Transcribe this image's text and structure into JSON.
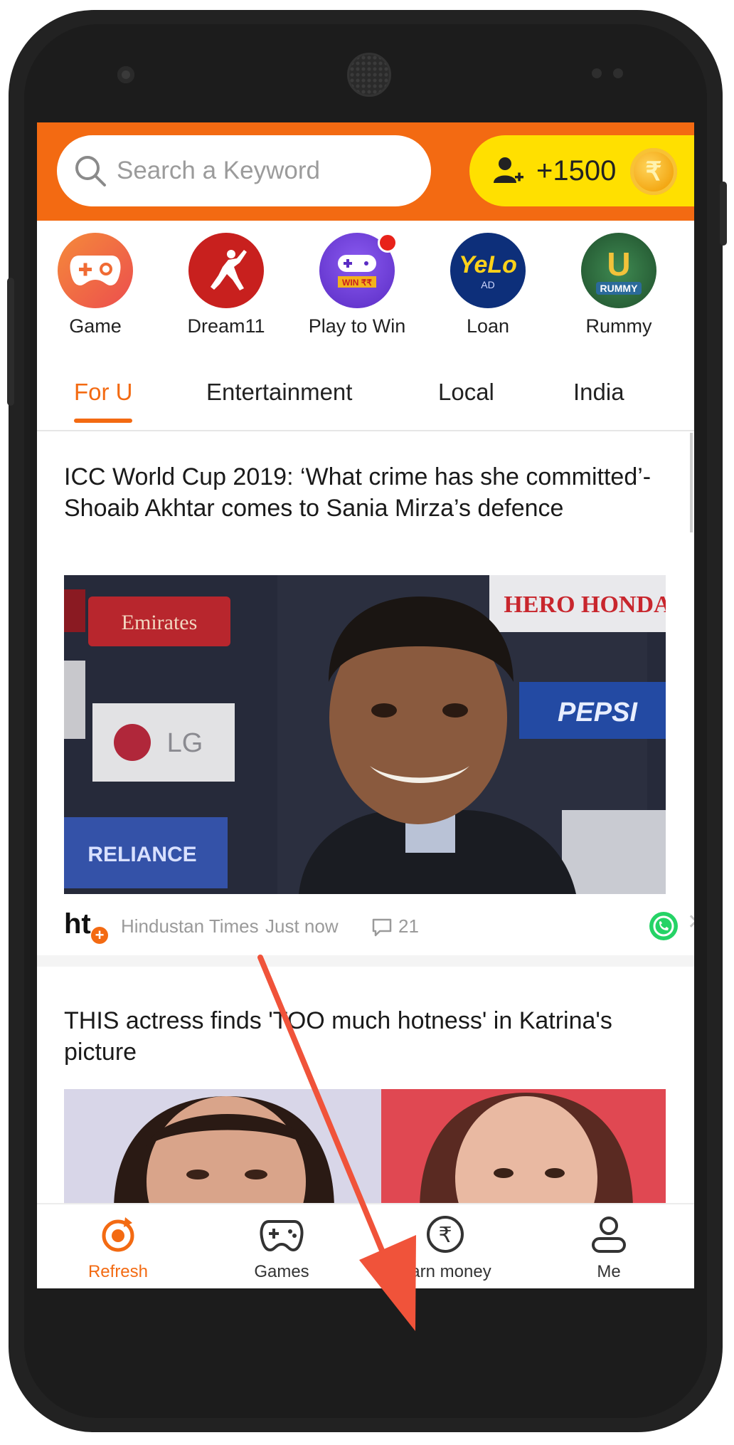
{
  "search": {
    "placeholder": "Search a Keyword"
  },
  "rewards": {
    "amount": "+1500",
    "currency_symbol": "₹"
  },
  "quick_apps": [
    {
      "label": "Game",
      "icon": "gamepad-icon",
      "color": "#f06b34"
    },
    {
      "label": "Dream11",
      "icon": "cricket-batsman-icon",
      "color": "#c8201e"
    },
    {
      "label": "Play to Win",
      "icon": "joystick-icon",
      "color": "#6a3bd6",
      "badge": "WIN ₹₹"
    },
    {
      "label": "Loan",
      "icon": "yelo-logo-icon",
      "color": "#0d2f7a",
      "logo": "YeLo",
      "sub": "AD"
    },
    {
      "label": "Rummy",
      "icon": "rummy-logo-icon",
      "color": "#2f6a3d",
      "logo": "U",
      "sub": "RUMMY"
    }
  ],
  "tabs": [
    {
      "label": "For U",
      "active": true
    },
    {
      "label": "Entertainment",
      "active": false
    },
    {
      "label": "Local",
      "active": false
    },
    {
      "label": "India",
      "active": false
    }
  ],
  "articles": [
    {
      "headline": "ICC World Cup 2019: ‘What crime has she committed’- Shoaib Akhtar comes to Sania Mirza’s defence",
      "source": "Hindustan Times",
      "time": "Just now",
      "comments": "21",
      "source_logo": "ht"
    },
    {
      "headline": "THIS actress finds 'TOO much hotness' in Katrina's picture"
    }
  ],
  "photo_backdrop": [
    "Emirates",
    "LG",
    "RELIANCE",
    "HERO HONDA",
    "PEPSI"
  ],
  "bottom_nav": [
    {
      "label": "Refresh",
      "icon": "refresh-icon",
      "active": true
    },
    {
      "label": "Games",
      "icon": "gamepad-icon",
      "active": false
    },
    {
      "label": "Earn money",
      "icon": "rupee-coin-icon",
      "active": false
    },
    {
      "label": "Me",
      "icon": "user-icon",
      "active": false
    }
  ],
  "colors": {
    "brand": "#f36a12",
    "coin_bar": "#ffe000",
    "whatsapp": "#25d366",
    "arrow": "#f0533a"
  }
}
